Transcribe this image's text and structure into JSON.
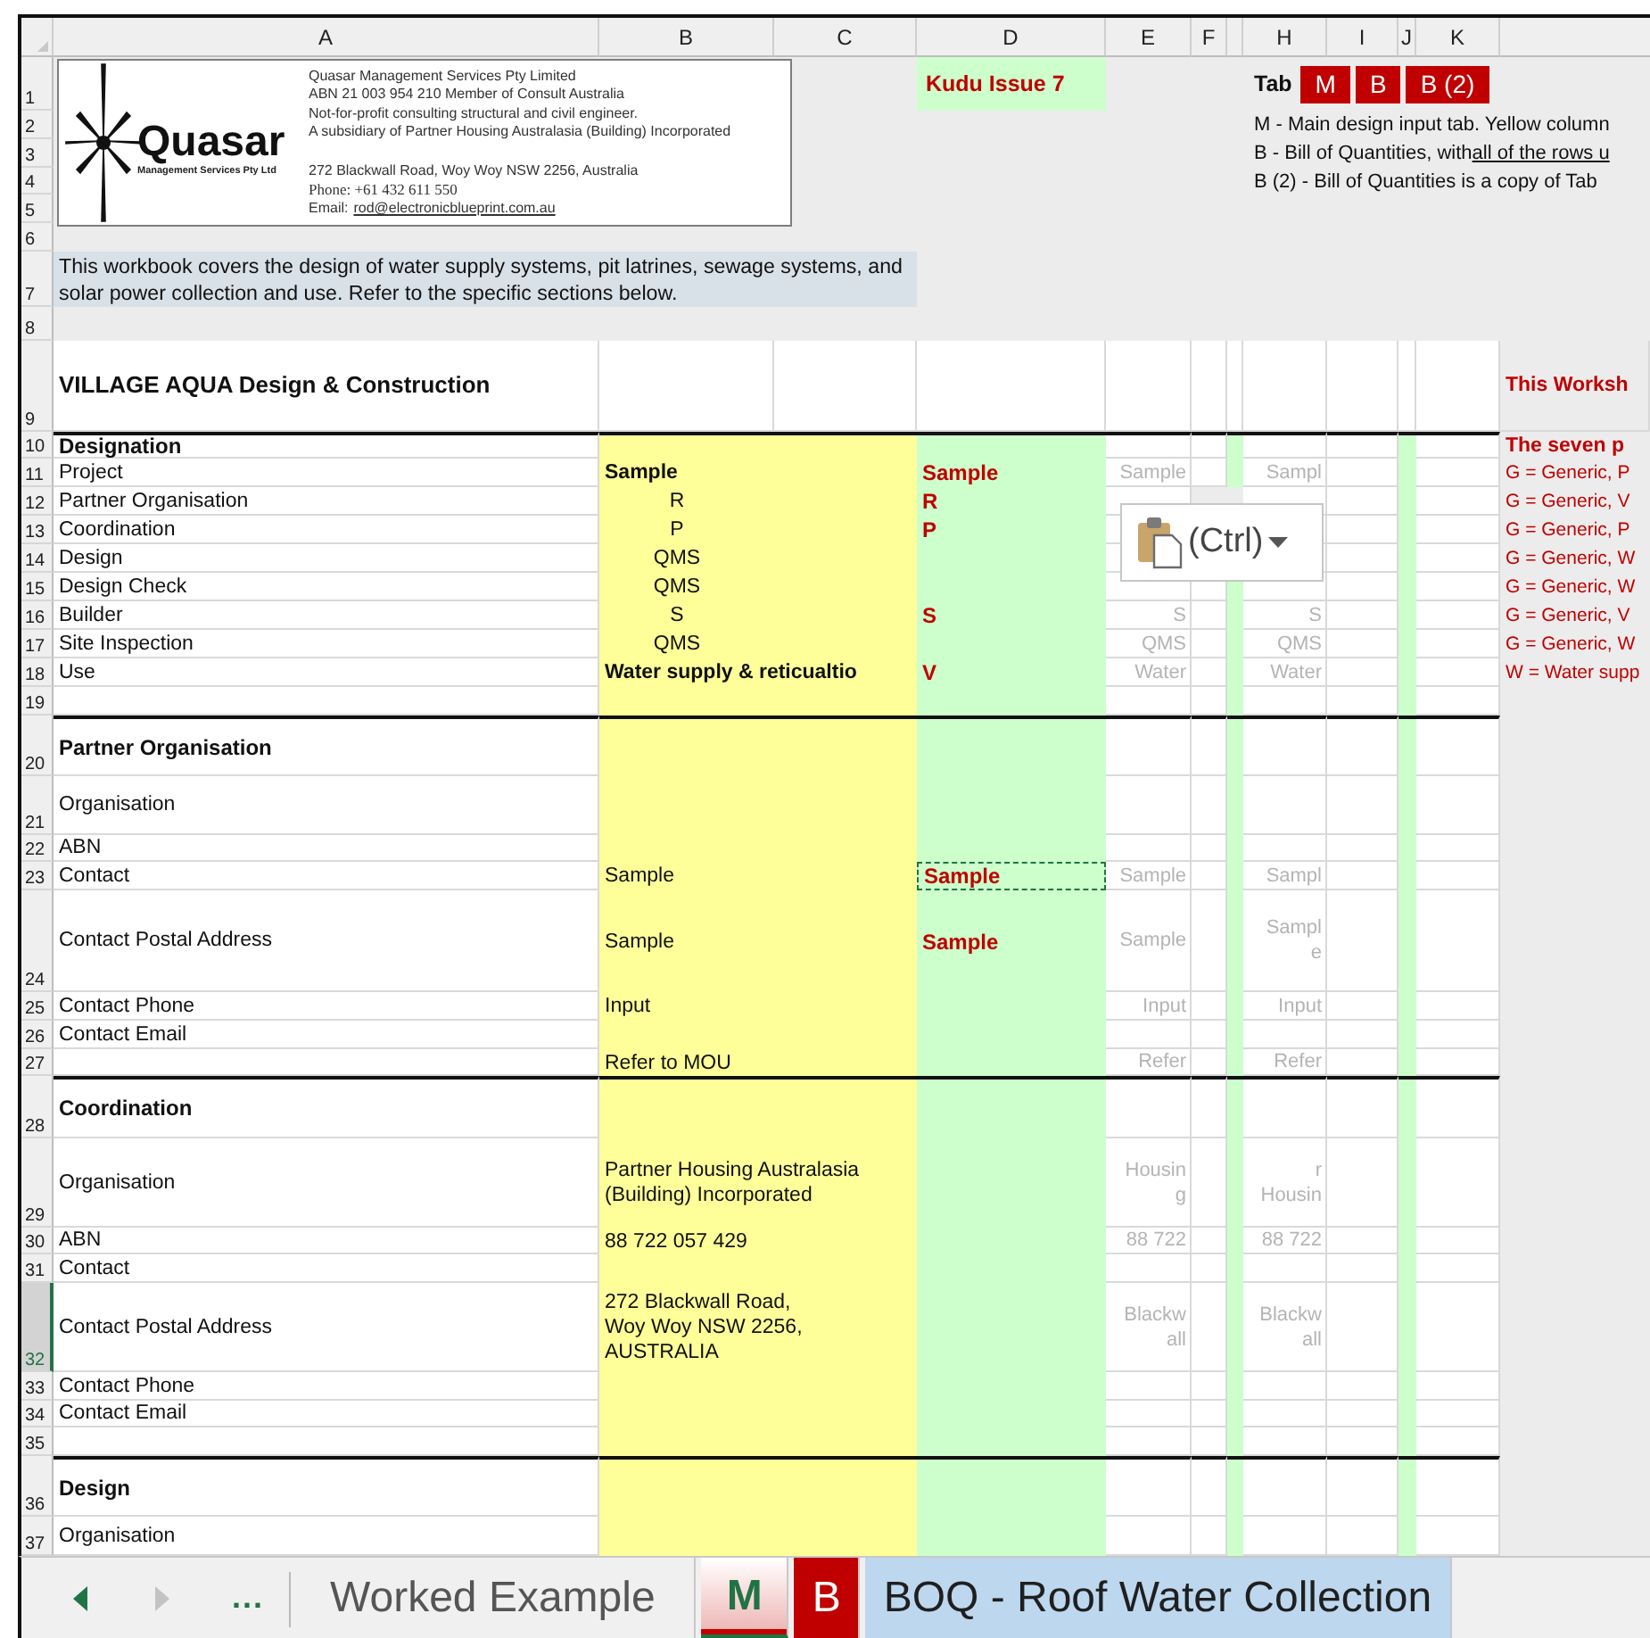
{
  "columns": [
    {
      "label": "A"
    },
    {
      "label": "B"
    },
    {
      "label": "C"
    },
    {
      "label": "D"
    },
    {
      "label": "E"
    },
    {
      "label": "F"
    },
    {
      "kind": "narrow"
    },
    {
      "label": "H"
    },
    {
      "label": "I"
    },
    {
      "label": "J"
    },
    {
      "label": "K"
    }
  ],
  "header": {
    "logo": {
      "name": "Quasar",
      "subtitle": "Management Services Pty Ltd",
      "company_lines": [
        "Quasar Management Services Pty Limited",
        "ABN 21 003 954 210   Member of Consult Australia",
        "Not-for-profit consulting structural and civil engineer.",
        "A subsidiary of Partner Housing Australasia (Building) Incorporated"
      ],
      "contact_lines": [
        "272 Blackwall Road, Woy Woy NSW 2256, Australia",
        "Phone: +61 432 611 550"
      ],
      "email_label": "Email:",
      "email": "rod@electronicblueprint.com.au"
    },
    "issue": "Kudu Issue 7",
    "tab_legend": {
      "label": "Tab",
      "buttons": [
        "M",
        "B",
        "B (2)"
      ],
      "lines": [
        [
          {
            "text": "M - Main design input tab. Yellow column"
          }
        ],
        [
          {
            "text": "B - Bill of Quantities, with "
          },
          {
            "text": "all of the rows u",
            "kind": "underlined"
          }
        ],
        [
          {
            "text": "B (2) - Bill of Quantities is a copy of Tab"
          }
        ]
      ]
    },
    "description": "This workbook covers the design of water supply systems, pit latrines, sewage systems, and solar power collection and use. Refer to the specific sections below."
  },
  "rows": [
    {
      "number": "1",
      "kind": "top",
      "selected": false
    },
    {
      "number": "2",
      "kind": "top",
      "selected": false
    },
    {
      "number": "3",
      "kind": "top",
      "selected": false
    },
    {
      "number": "4",
      "kind": "top",
      "selected": false
    },
    {
      "number": "5",
      "kind": "top",
      "selected": false
    },
    {
      "number": "6",
      "kind": "top",
      "selected": false
    },
    {
      "number": "7",
      "kind": "top",
      "selected": false
    },
    {
      "number": "8",
      "kind": "top",
      "selected": false
    },
    {
      "number": "9",
      "kind": "title",
      "selected": false,
      "cells": {
        "A": {
          "text": "VILLAGE AQUA Design & Construction",
          "kind": "title"
        },
        "L": {
          "text": "This Worksh",
          "kind": "note-heading"
        }
      }
    },
    {
      "number": "10",
      "kind": "section",
      "selected": false,
      "cells": {
        "A": {
          "text": "Designation",
          "kind": "section"
        },
        "L": {
          "text": "The seven p",
          "kind": "note-heading"
        }
      }
    },
    {
      "number": "11",
      "kind": "data",
      "selected": false,
      "cells": {
        "A": {
          "text": "Project",
          "kind": "label"
        },
        "B": {
          "text": "Sample",
          "kind": "key"
        },
        "D": {
          "text": "Sample",
          "kind": "flag"
        },
        "E": {
          "text": "Sample",
          "kind": "ghost"
        },
        "H": {
          "text": "Sampl",
          "kind": "ghost"
        },
        "L": {
          "text": "G = Generic, P",
          "kind": "note"
        }
      }
    },
    {
      "number": "12",
      "kind": "data",
      "selected": false,
      "cells": {
        "A": {
          "text": "Partner Organisation",
          "kind": "label"
        },
        "B": {
          "text": "R",
          "kind": "code"
        },
        "D": {
          "text": "R",
          "kind": "flag"
        },
        "L": {
          "text": "G = Generic, V",
          "kind": "note"
        }
      }
    },
    {
      "number": "13",
      "kind": "data",
      "selected": false,
      "cells": {
        "A": {
          "text": "Coordination",
          "kind": "label"
        },
        "B": {
          "text": "P",
          "kind": "code"
        },
        "D": {
          "text": "P",
          "kind": "flag"
        },
        "L": {
          "text": "G = Generic, P",
          "kind": "note"
        }
      }
    },
    {
      "number": "14",
      "kind": "data",
      "selected": false,
      "cells": {
        "A": {
          "text": "Design",
          "kind": "label"
        },
        "B": {
          "text": "QMS",
          "kind": "code"
        },
        "L": {
          "text": "G = Generic, W",
          "kind": "note"
        }
      }
    },
    {
      "number": "15",
      "kind": "data",
      "selected": false,
      "cells": {
        "A": {
          "text": "Design Check",
          "kind": "label"
        },
        "B": {
          "text": "QMS",
          "kind": "code"
        },
        "L": {
          "text": "G = Generic, W",
          "kind": "note"
        }
      }
    },
    {
      "number": "16",
      "kind": "data",
      "selected": false,
      "cells": {
        "A": {
          "text": "Builder",
          "kind": "label"
        },
        "B": {
          "text": "S",
          "kind": "code"
        },
        "D": {
          "text": "S",
          "kind": "flag"
        },
        "E": {
          "text": "S",
          "kind": "ghost"
        },
        "H": {
          "text": "S",
          "kind": "ghost"
        },
        "L": {
          "text": "G = Generic, V",
          "kind": "note"
        }
      }
    },
    {
      "number": "17",
      "kind": "data",
      "selected": false,
      "cells": {
        "A": {
          "text": "Site Inspection",
          "kind": "label"
        },
        "B": {
          "text": "QMS",
          "kind": "code"
        },
        "E": {
          "text": "QMS",
          "kind": "ghost"
        },
        "H": {
          "text": "QMS",
          "kind": "ghost"
        },
        "L": {
          "text": "G = Generic, W",
          "kind": "note"
        }
      }
    },
    {
      "number": "18",
      "kind": "data",
      "selected": false,
      "cells": {
        "A": {
          "text": "Use",
          "kind": "label"
        },
        "B": {
          "text": "Water supply & reticualtio",
          "kind": "key"
        },
        "D": {
          "text": "V",
          "kind": "flag"
        },
        "E": {
          "text": "Water",
          "kind": "ghost"
        },
        "H": {
          "text": "Water",
          "kind": "ghost"
        },
        "L": {
          "text": "W = Water supp",
          "kind": "note"
        }
      }
    },
    {
      "number": "19",
      "kind": "data",
      "selected": false
    },
    {
      "number": "20",
      "kind": "section",
      "selected": false,
      "cells": {
        "A": {
          "text": "Partner Organisation",
          "kind": "section"
        }
      }
    },
    {
      "number": "21",
      "kind": "data",
      "selected": false,
      "cells": {
        "A": {
          "text": "Organisation",
          "kind": "label"
        }
      }
    },
    {
      "number": "22",
      "kind": "data",
      "selected": false,
      "cells": {
        "A": {
          "text": "ABN",
          "kind": "label"
        }
      }
    },
    {
      "number": "23",
      "kind": "data",
      "selected": false,
      "cells": {
        "A": {
          "text": "Contact",
          "kind": "label"
        },
        "B": {
          "text": "Sample",
          "kind": "text"
        },
        "D": {
          "text": "Sample",
          "kind": "copied"
        },
        "E": {
          "text": "Sample",
          "kind": "ghost"
        },
        "H": {
          "text": "Sampl",
          "kind": "ghost"
        }
      }
    },
    {
      "number": "24",
      "kind": "data",
      "selected": false,
      "cells": {
        "A": {
          "text": "Contact Postal Address",
          "kind": "label"
        },
        "B": {
          "text": "Sample",
          "kind": "text"
        },
        "D": {
          "text": "Sample",
          "kind": "flag"
        },
        "E": {
          "text": "Sample",
          "kind": "ghost"
        },
        "H": {
          "text": "Sampl\ne",
          "kind": "ghost"
        }
      }
    },
    {
      "number": "25",
      "kind": "data",
      "selected": false,
      "cells": {
        "A": {
          "text": "Contact Phone",
          "kind": "label"
        },
        "B": {
          "text": "Input",
          "kind": "text"
        },
        "E": {
          "text": "Input",
          "kind": "ghost"
        },
        "H": {
          "text": "Input",
          "kind": "ghost"
        }
      }
    },
    {
      "number": "26",
      "kind": "data",
      "selected": false,
      "cells": {
        "A": {
          "text": "Contact Email",
          "kind": "label"
        }
      }
    },
    {
      "number": "27",
      "kind": "data",
      "selected": false,
      "cells": {
        "B": {
          "text": "Refer to MOU",
          "kind": "text"
        },
        "E": {
          "text": "Refer",
          "kind": "ghost"
        },
        "H": {
          "text": "Refer",
          "kind": "ghost"
        }
      }
    },
    {
      "number": "28",
      "kind": "section",
      "selected": false,
      "cells": {
        "A": {
          "text": "Coordination",
          "kind": "section"
        }
      }
    },
    {
      "number": "29",
      "kind": "data",
      "selected": false,
      "cells": {
        "A": {
          "text": "Organisation",
          "kind": "label"
        },
        "B": {
          "text": "Partner Housing Australasia\n(Building) Incorporated",
          "kind": "text"
        },
        "E": {
          "text": "Housin\ng",
          "kind": "ghost"
        },
        "H": {
          "text": "r\nHousin",
          "kind": "ghost"
        }
      }
    },
    {
      "number": "30",
      "kind": "data",
      "selected": false,
      "cells": {
        "A": {
          "text": "ABN",
          "kind": "label"
        },
        "B": {
          "text": "88 722 057 429",
          "kind": "text"
        },
        "E": {
          "text": "88 722",
          "kind": "ghost"
        },
        "H": {
          "text": "88 722",
          "kind": "ghost"
        }
      }
    },
    {
      "number": "31",
      "kind": "data",
      "selected": false,
      "cells": {
        "A": {
          "text": "Contact",
          "kind": "label"
        }
      }
    },
    {
      "number": "32",
      "kind": "data",
      "selected": true,
      "cells": {
        "A": {
          "text": "Contact Postal Address",
          "kind": "label"
        },
        "B": {
          "text": "272 Blackwall Road,\nWoy Woy NSW 2256,\nAUSTRALIA",
          "kind": "text"
        },
        "E": {
          "text": "Blackw\nall",
          "kind": "ghost"
        },
        "H": {
          "text": "Blackw\nall",
          "kind": "ghost"
        }
      }
    },
    {
      "number": "33",
      "kind": "data",
      "selected": false,
      "cells": {
        "A": {
          "text": "Contact Phone",
          "kind": "label"
        }
      }
    },
    {
      "number": "34",
      "kind": "data",
      "selected": false,
      "cells": {
        "A": {
          "text": "Contact Email",
          "kind": "label"
        }
      }
    },
    {
      "number": "35",
      "kind": "data",
      "selected": false
    },
    {
      "number": "36",
      "kind": "section",
      "selected": false,
      "cells": {
        "A": {
          "text": "Design",
          "kind": "section"
        }
      }
    },
    {
      "number": "37",
      "kind": "data",
      "selected": false,
      "cells": {
        "A": {
          "text": "Organisation",
          "kind": "label"
        }
      }
    }
  ],
  "paste_options": {
    "label": "(Ctrl)"
  },
  "nav_buttons": [
    {
      "kind": "prev",
      "disabled": false
    },
    {
      "kind": "next",
      "disabled": true
    }
  ],
  "more_tabs": "...",
  "sheet_tabs": [
    {
      "label": "Worked Example",
      "selected": false
    },
    {
      "label": "M",
      "selected": true,
      "color": "#c00000"
    },
    {
      "label": "B",
      "selected": false,
      "color": "#c00000"
    },
    {
      "label": "BOQ - Roof Water Collection",
      "selected": false,
      "color": "#bdd7ee"
    }
  ]
}
